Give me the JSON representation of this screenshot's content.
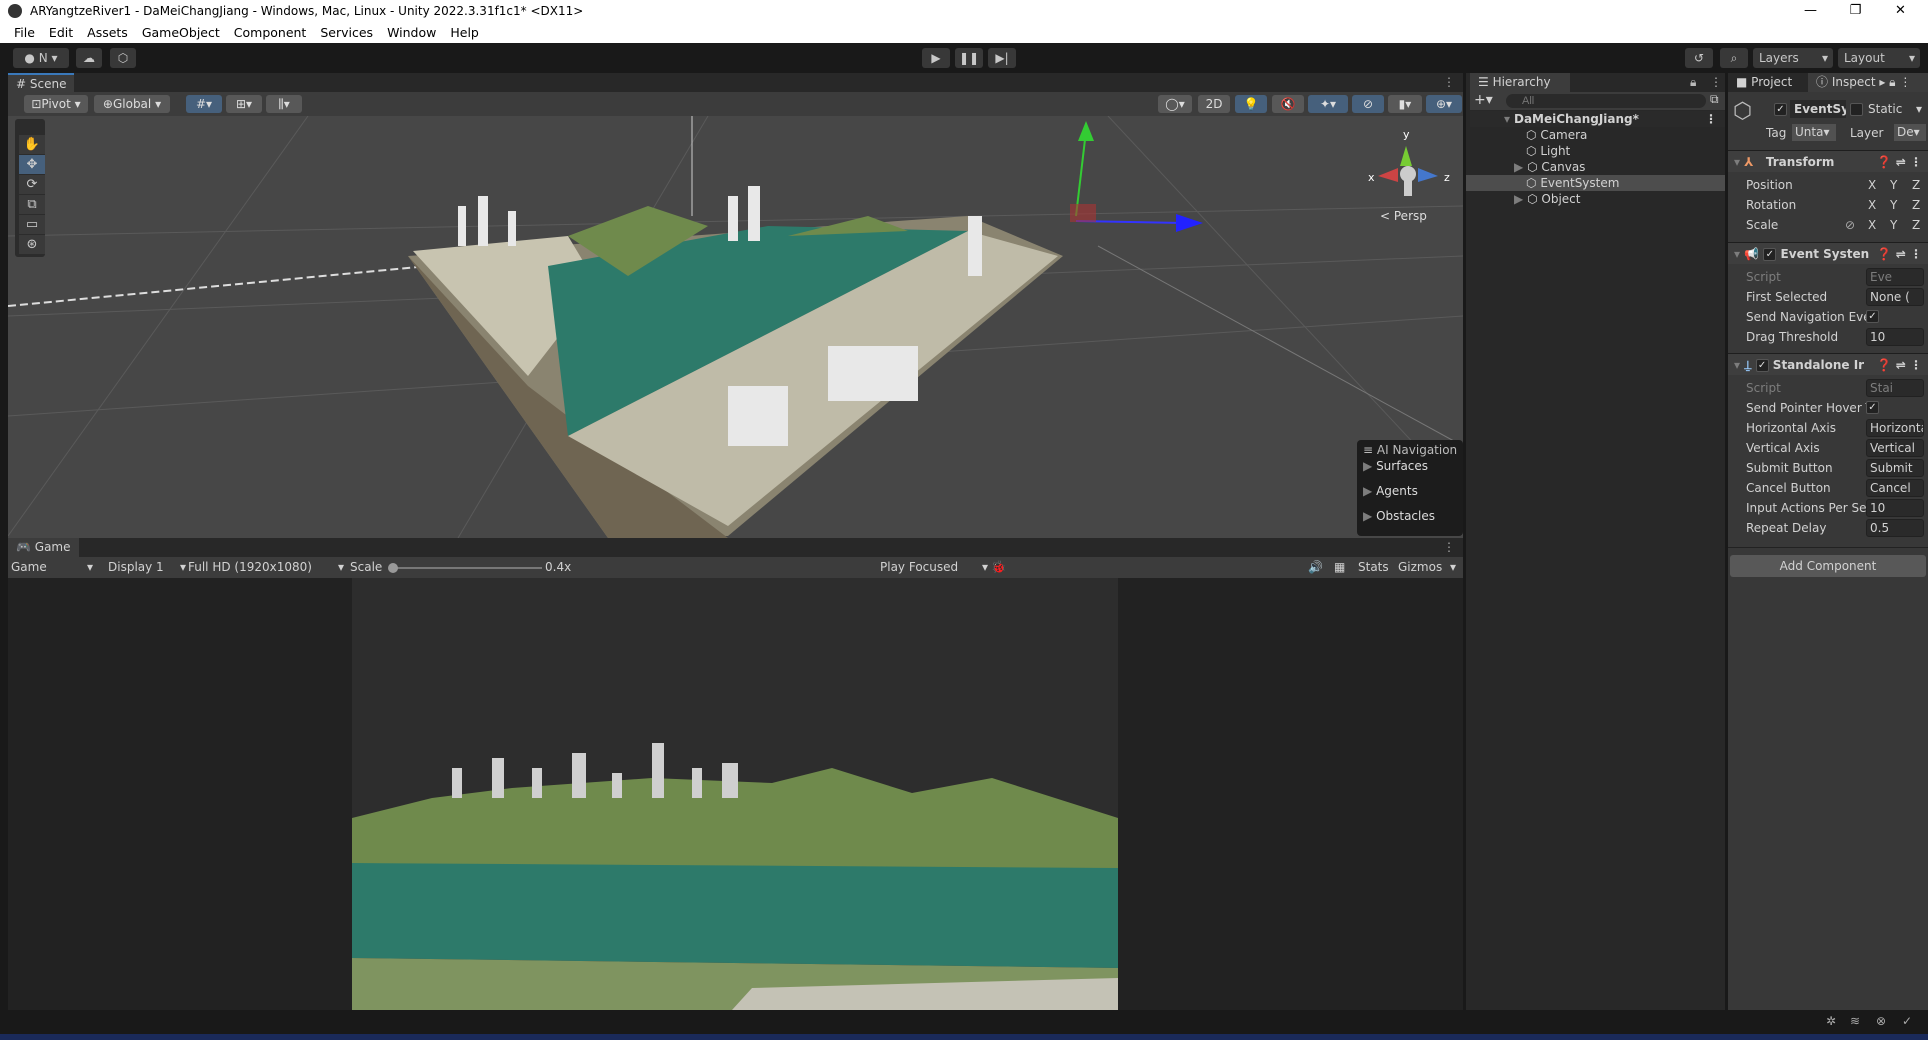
{
  "window": {
    "title": "ARYangtzeRiver1 - DaMeiChangJiang - Windows, Mac, Linux - Unity 2022.3.31f1c1* <DX11>",
    "minimize": "—",
    "maximize": "❐",
    "close": "✕"
  },
  "menu": [
    "File",
    "Edit",
    "Assets",
    "GameObject",
    "Component",
    "Services",
    "Window",
    "Help"
  ],
  "toolbar": {
    "account": "N",
    "layers": "Layers",
    "layout": "Layout"
  },
  "scene": {
    "tab": "Scene",
    "pivot": "Pivot",
    "global": "Global",
    "mode_2d": "2D",
    "persp": "Persp",
    "gizmo_axes": {
      "x": "x",
      "y": "y",
      "z": "z"
    },
    "ai_nav": {
      "title": "AI Navigation",
      "items": [
        "Surfaces",
        "Agents",
        "Obstacles"
      ]
    }
  },
  "game": {
    "tab": "Game",
    "mode": "Game",
    "display": "Display 1",
    "resolution": "Full HD (1920x1080)",
    "scale_label": "Scale",
    "scale_value": "0.4x",
    "play_mode": "Play Focused",
    "stats": "Stats",
    "gizmos": "Gizmos"
  },
  "hierarchy": {
    "tab": "Hierarchy",
    "search_placeholder": "All",
    "scene": "DaMeiChangJiang*",
    "items": [
      {
        "name": "Camera",
        "expandable": false
      },
      {
        "name": "Light",
        "expandable": false
      },
      {
        "name": "Canvas",
        "expandable": true
      },
      {
        "name": "EventSystem",
        "expandable": false,
        "selected": true
      },
      {
        "name": "Object",
        "expandable": true
      }
    ]
  },
  "inspector": {
    "tab_project": "Project",
    "tab_inspector": "Inspect",
    "object_name": "EventSy",
    "static": "Static",
    "tag_label": "Tag",
    "tag": "Unta",
    "layer_label": "Layer",
    "layer": "De",
    "transform": {
      "title": "Transform",
      "rows": [
        "Position",
        "Rotation",
        "Scale"
      ],
      "x": "X",
      "y": "Y",
      "z": "Z"
    },
    "event_system": {
      "title": "Event Systen",
      "script_label": "Script",
      "script": "Eve",
      "first_selected_label": "First Selected",
      "first_selected": "None (",
      "send_nav_label": "Send Navigation Evei",
      "send_nav": true,
      "drag_label": "Drag Threshold",
      "drag": "10"
    },
    "standalone": {
      "title": "Standalone Ir",
      "script_label": "Script",
      "script": "Stai",
      "send_hover_label": "Send Pointer Hover T",
      "send_hover": true,
      "rows": [
        {
          "label": "Horizontal Axis",
          "value": "Horizonta"
        },
        {
          "label": "Vertical Axis",
          "value": "Vertical"
        },
        {
          "label": "Submit Button",
          "value": "Submit"
        },
        {
          "label": "Cancel Button",
          "value": "Cancel"
        },
        {
          "label": "Input Actions Per Sec",
          "value": "10"
        },
        {
          "label": "Repeat Delay",
          "value": "0.5"
        }
      ]
    },
    "add_component": "Add Component"
  },
  "colors": {
    "accent": "#3a79bb",
    "panel": "#282828",
    "header": "#3c3c3c",
    "water": "#2d7a6a",
    "terrain": "#6f8a4c"
  }
}
